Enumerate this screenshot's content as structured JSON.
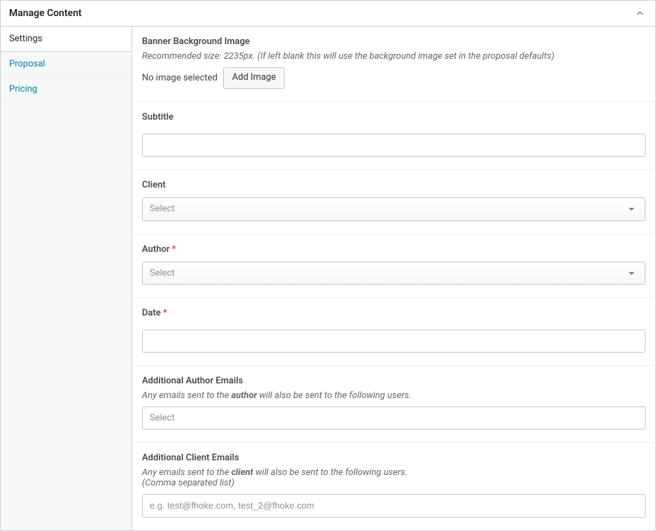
{
  "header": {
    "title": "Manage Content"
  },
  "sidebar": {
    "items": [
      {
        "label": "Settings",
        "active": true
      },
      {
        "label": "Proposal",
        "active": false
      },
      {
        "label": "Pricing",
        "active": false
      }
    ]
  },
  "banner": {
    "label": "Banner Background Image",
    "desc": "Recommended size: 2235px. (If left blank this will use the background image set in the proposal defaults)",
    "no_image_text": "No image selected",
    "add_button": "Add Image"
  },
  "subtitle": {
    "label": "Subtitle",
    "value": ""
  },
  "client": {
    "label": "Client",
    "placeholder": "Select"
  },
  "author": {
    "label": "Author",
    "required": "*",
    "placeholder": "Select"
  },
  "date": {
    "label": "Date",
    "required": "*",
    "value": ""
  },
  "additional_author": {
    "label": "Additional Author Emails",
    "desc_pre": "Any emails sent to the ",
    "desc_bold": "author",
    "desc_post": " will also be sent to the following users.",
    "placeholder": "Select"
  },
  "additional_client": {
    "label": "Additional Client Emails",
    "desc_pre": "Any emails sent to the ",
    "desc_bold": "client",
    "desc_post": " will also be sent to the following users.",
    "desc_line2": "(Comma separated list)",
    "placeholder": "e.g. test@fhoke.com, test_2@fhoke.com"
  }
}
